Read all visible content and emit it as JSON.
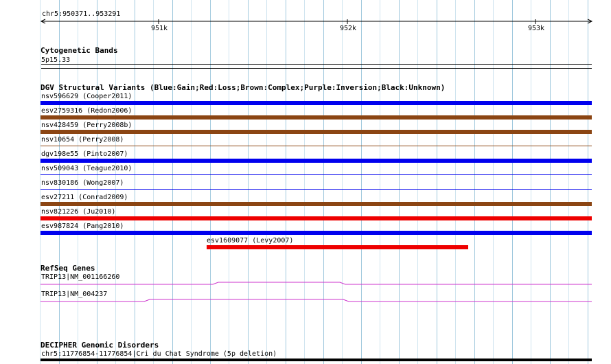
{
  "ruler": {
    "coordinates": "chr5:950371..953291",
    "ticks": [
      "951k",
      "952k",
      "953k"
    ]
  },
  "cytobands": {
    "title": "Cytogenetic Bands",
    "band": "5p15.33"
  },
  "dgv": {
    "title": "DGV Structural Variants (Blue:Gain;Red:Loss;Brown:Complex;Purple:Inversion;Black:Unknown)",
    "colors": {
      "gain": "#0000ee",
      "loss": "#ee0000",
      "complex": "#8b4513"
    },
    "variants": [
      {
        "label": "nsv596629 (Cooper2011)",
        "type": "gain"
      },
      {
        "label": "esv2759316 (Redon2006)",
        "type": "complex"
      },
      {
        "label": "nsv428459 (Perry2008b)",
        "type": "complex"
      },
      {
        "label": "nsv10654 (Perry2008)",
        "type": "complex"
      },
      {
        "label": "dgv198e55 (Pinto2007)",
        "type": "gain"
      },
      {
        "label": "nsv509043 (Teague2010)",
        "type": "gain"
      },
      {
        "label": "nsv830186 (Wong2007)",
        "type": "gain"
      },
      {
        "label": "esv27211 (Conrad2009)",
        "type": "complex"
      },
      {
        "label": "nsv821226 (Ju2010)",
        "type": "loss"
      },
      {
        "label": "esv987824 (Pang2010)",
        "type": "gain"
      },
      {
        "label": "esv1609077 (Levy2007)",
        "type": "loss"
      }
    ]
  },
  "refseq": {
    "title": "RefSeq Genes",
    "color": "#cc33cc",
    "genes": [
      {
        "label": "TRIP13|NM_001166260"
      },
      {
        "label": "TRIP13|NM_004237"
      }
    ]
  },
  "decipher": {
    "title": "DECIPHER Genomic Disorders",
    "record": "chr5:11776854-11776854|Cri du Chat Syndrome (5p deletion)"
  }
}
